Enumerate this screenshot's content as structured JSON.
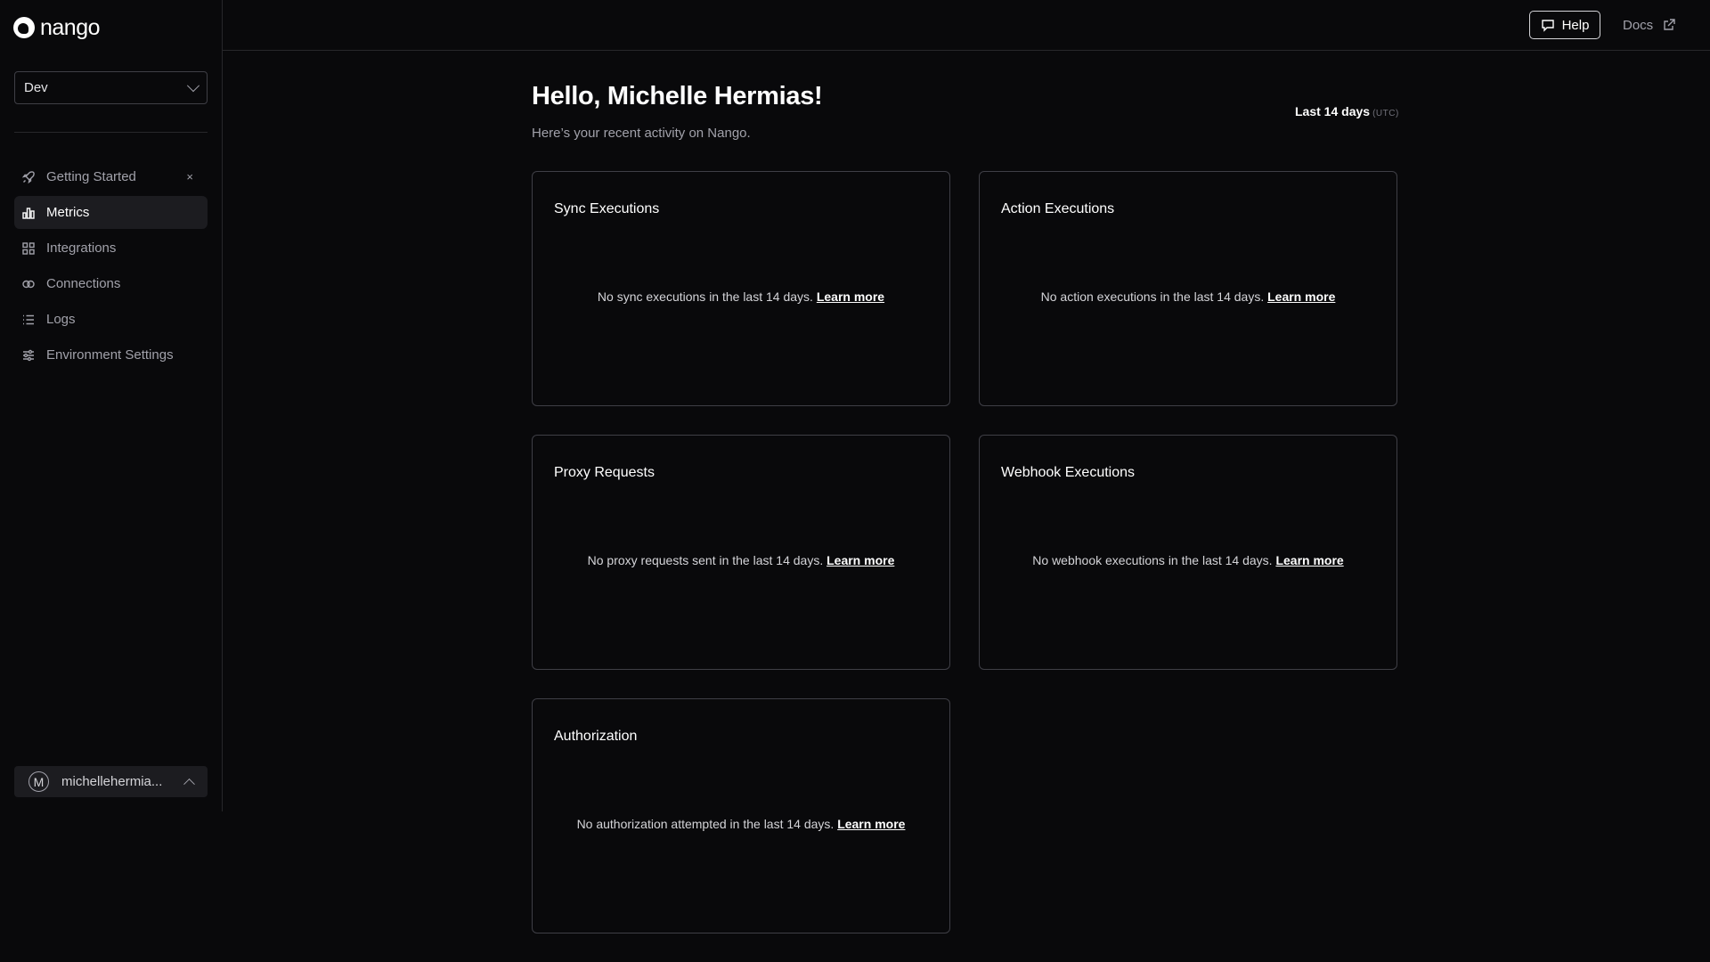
{
  "sidebar": {
    "logo_text": "nango",
    "environment": {
      "selected": "Dev"
    },
    "items": [
      {
        "label": "Getting Started",
        "icon": "rocket-icon",
        "dismiss": "×"
      },
      {
        "label": "Metrics",
        "icon": "bar-chart-icon",
        "active": true
      },
      {
        "label": "Integrations",
        "icon": "grid-icon"
      },
      {
        "label": "Connections",
        "icon": "link-icon"
      },
      {
        "label": "Logs",
        "icon": "list-icon"
      },
      {
        "label": "Environment Settings",
        "icon": "sliders-icon"
      }
    ],
    "user": {
      "initial": "M",
      "name": "michellehermia..."
    }
  },
  "header": {
    "help_label": "Help",
    "docs_label": "Docs"
  },
  "main": {
    "greeting": "Hello, Michelle Hermias!",
    "subtitle": "Here’s your recent activity on Nango.",
    "range_label": "Last 14 days",
    "range_tz": "(UTC)",
    "cards": [
      {
        "title": "Sync Executions",
        "empty_text": "No sync executions in the last 14 days.",
        "link": "Learn more"
      },
      {
        "title": "Action Executions",
        "empty_text": "No action executions in the last 14 days.",
        "link": "Learn more"
      },
      {
        "title": "Proxy Requests",
        "empty_text": "No proxy requests sent in the last 14 days.",
        "link": "Learn more"
      },
      {
        "title": "Webhook Executions",
        "empty_text": "No webhook executions in the last 14 days.",
        "link": "Learn more"
      },
      {
        "title": "Authorization",
        "empty_text": "No authorization attempted in the last 14 days.",
        "link": "Learn more"
      }
    ]
  },
  "colors": {
    "background": "#09090b",
    "border": "#3f3f46",
    "text_muted": "#a1a1aa",
    "active_bg": "#1c1c20"
  }
}
